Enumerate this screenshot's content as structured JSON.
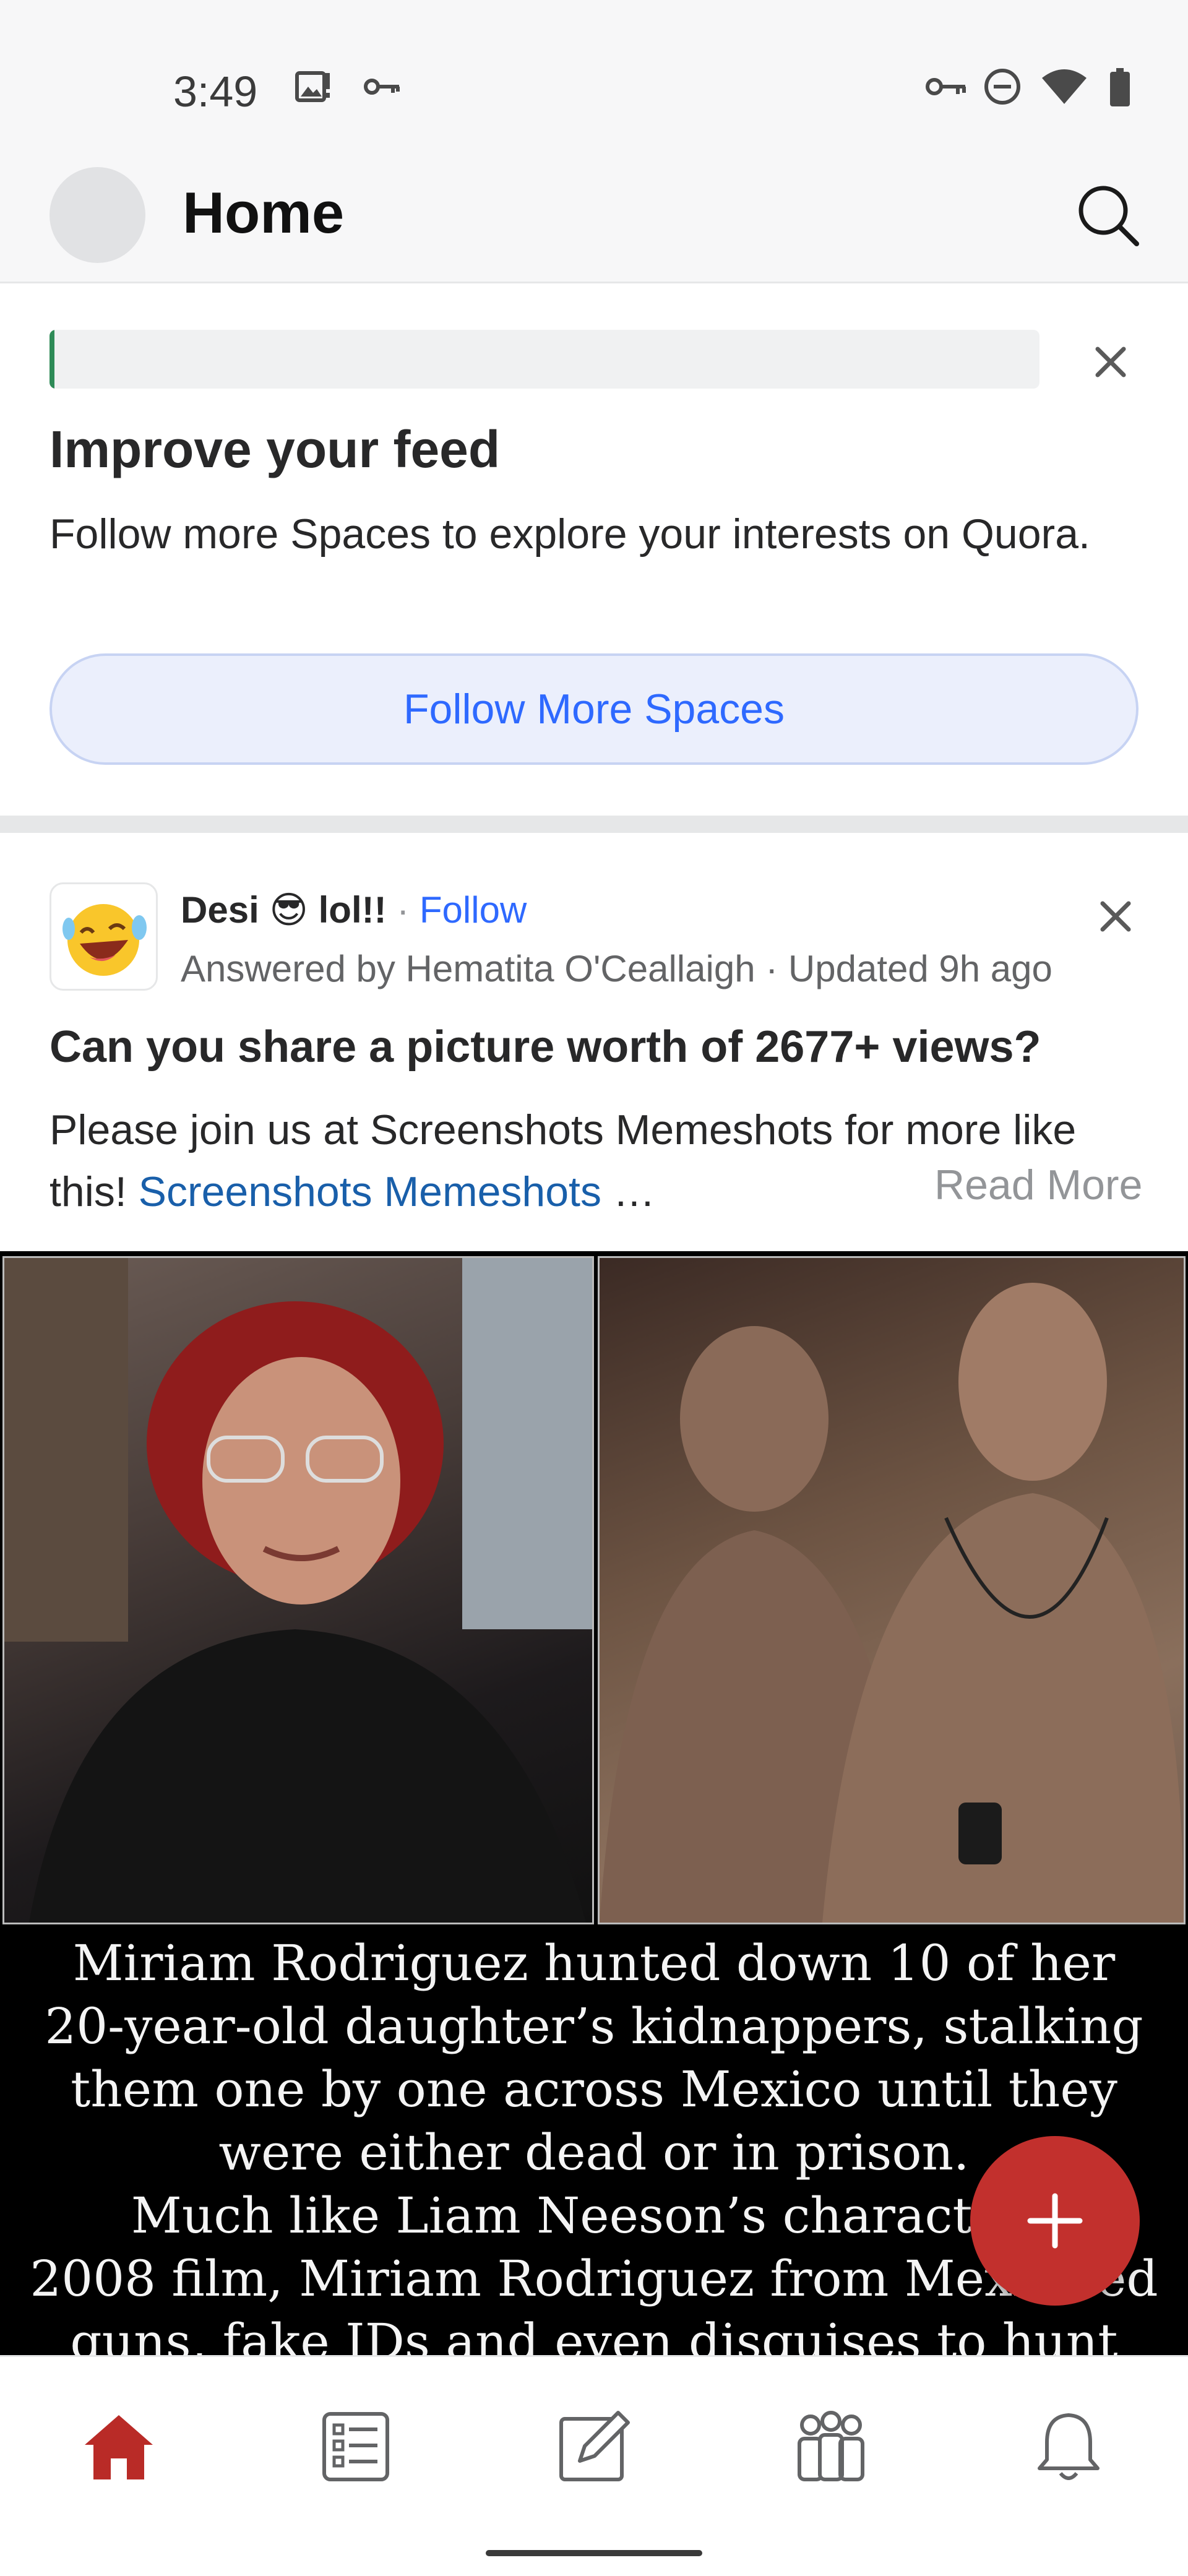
{
  "status_bar": {
    "time": "3:49"
  },
  "header": {
    "title": "Home"
  },
  "improve_card": {
    "progress_fraction": 0.005,
    "title": "Improve your feed",
    "text": "Follow more Spaces to explore your interests on Quora.",
    "button_label": "Follow More Spaces"
  },
  "post": {
    "space_name": "Desi 😎 lol!!",
    "separator": "·",
    "follow_label": "Follow",
    "byline": "Answered by Hematita O'Ceallaigh  · Updated 9h ago",
    "question": "Can you share a picture worth of 2677+ views?",
    "excerpt_text": "Please join us at Screenshots Memeshots for more like this! ",
    "excerpt_link": "Screenshots Memeshots",
    "excerpt_ellipsis": " …",
    "read_more": "Read More",
    "image_caption_lines": [
      "Miriam Rodriguez hunted down 10 of her",
      "20-year-old daughter’s kidnappers, stalking",
      "them one by one across Mexico until they",
      "were either dead or in prison.",
      "Much like Liam Neeson’s character i",
      "2008 film, Miriam Rodriguez from Mexic   sed",
      "guns, fake IDs and even disguises to hunt down"
    ]
  },
  "colors": {
    "brand_red": "#b92b27",
    "fab_red": "#c2302d",
    "link_blue": "#2e69ff",
    "progress_green": "#2e8b57"
  },
  "bottom_nav": [
    {
      "icon": "home-icon",
      "active": true
    },
    {
      "icon": "following-icon",
      "active": false
    },
    {
      "icon": "answer-icon",
      "active": false
    },
    {
      "icon": "spaces-icon",
      "active": false
    },
    {
      "icon": "notifications-icon",
      "active": false
    }
  ]
}
